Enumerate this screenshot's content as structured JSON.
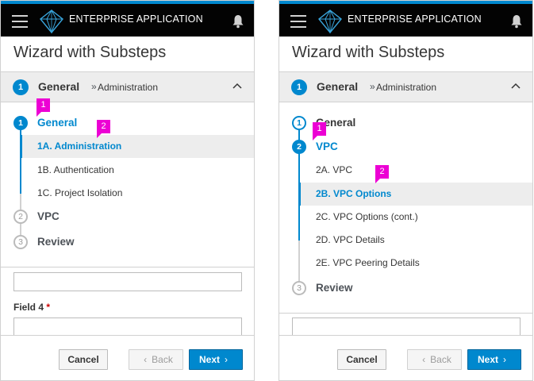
{
  "masthead": {
    "title": "ENTERPRISE APPLICATION"
  },
  "wizard": {
    "title": "Wizard with Substeps",
    "footer": {
      "cancel_label": "Cancel",
      "back_label": "Back",
      "next_label": "Next"
    }
  },
  "left_screen": {
    "stepbar": {
      "number": "1",
      "step": "General",
      "separator": "»",
      "substep": "Administration"
    },
    "steps": [
      {
        "number": "1",
        "label": "General"
      },
      {
        "number": "2",
        "label": "VPC"
      },
      {
        "number": "3",
        "label": "Review"
      }
    ],
    "substeps": [
      "1A. Administration",
      "1B. Authentication",
      "1C. Project Isolation"
    ],
    "field_label": "Field 4",
    "required_mark": "*",
    "callouts": [
      "1",
      "2"
    ]
  },
  "right_screen": {
    "stepbar": {
      "number": "1",
      "step": "General",
      "separator": "»",
      "substep": "Administration"
    },
    "steps": [
      {
        "number": "1",
        "label": "General"
      },
      {
        "number": "2",
        "label": "VPC"
      },
      {
        "number": "3",
        "label": "Review"
      }
    ],
    "substeps": [
      "2A. VPC",
      "2B. VPC Options",
      "2C. VPC Options (cont.)",
      "2D. VPC Details",
      "2E. VPC Peering Details"
    ],
    "callouts": [
      "1",
      "2"
    ]
  },
  "colors": {
    "accent": "#0088ce",
    "masthead": "#030303",
    "callout": "#ec00d4"
  },
  "icons": [
    "hamburger-icon",
    "brand-logo-icon",
    "bell-icon",
    "caret-up-icon",
    "chevron-left-icon",
    "chevron-right-icon"
  ]
}
